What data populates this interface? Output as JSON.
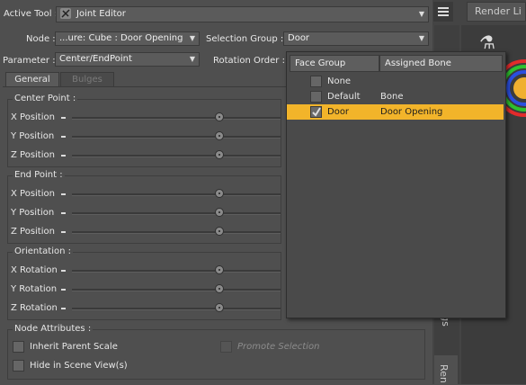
{
  "toolbar": {
    "active_tool_label": "Active Tool :",
    "active_tool_value": "Joint Editor",
    "tool_icon": "joint-tool-icon"
  },
  "node": {
    "label": "Node :",
    "value": "...ure: Cube : Door Opening"
  },
  "selection_group": {
    "label": "Selection Group :",
    "value": "Door"
  },
  "parameter": {
    "label": "Parameter :",
    "value": "Center/EndPoint"
  },
  "rotation_order": {
    "label": "Rotation Order :"
  },
  "tabs": [
    {
      "label": "General"
    },
    {
      "label": "Bulges"
    }
  ],
  "center_point": {
    "title": "Center Point :",
    "rows": [
      {
        "label": "X Position"
      },
      {
        "label": "Y Position"
      },
      {
        "label": "Z Position"
      }
    ]
  },
  "end_point": {
    "title": "End Point :",
    "rows": [
      {
        "label": "X Position"
      },
      {
        "label": "Y Position"
      },
      {
        "label": "Z Position"
      }
    ]
  },
  "orientation": {
    "title": "Orientation :",
    "rows": [
      {
        "label": "X Rotation"
      },
      {
        "label": "Y Rotation"
      },
      {
        "label": "Z Rotation"
      }
    ]
  },
  "node_attributes": {
    "title": "Node Attributes :",
    "inherit_parent_scale": "Inherit Parent Scale",
    "promote_selection": "Promote Selection",
    "hide_in_scene_view": "Hide in Scene View(s)"
  },
  "popup": {
    "col_face_group": "Face Group",
    "col_assigned_bone": "Assigned Bone",
    "rows": [
      {
        "face_group": "None",
        "bone": "",
        "checked": false,
        "selected": false
      },
      {
        "face_group": "Default",
        "bone": "Bone",
        "checked": false,
        "selected": false
      },
      {
        "face_group": "Door",
        "bone": "Door Opening",
        "checked": true,
        "selected": true
      }
    ]
  },
  "right_panel": {
    "tab_render_library": "Render Li",
    "side_tab_1": "gs",
    "side_tab_2": "Ren"
  },
  "colors": {
    "selection_highlight": "#f2b42a",
    "panel_bg": "#4f4f4f",
    "viewport_bg": "#3c3c3c"
  }
}
